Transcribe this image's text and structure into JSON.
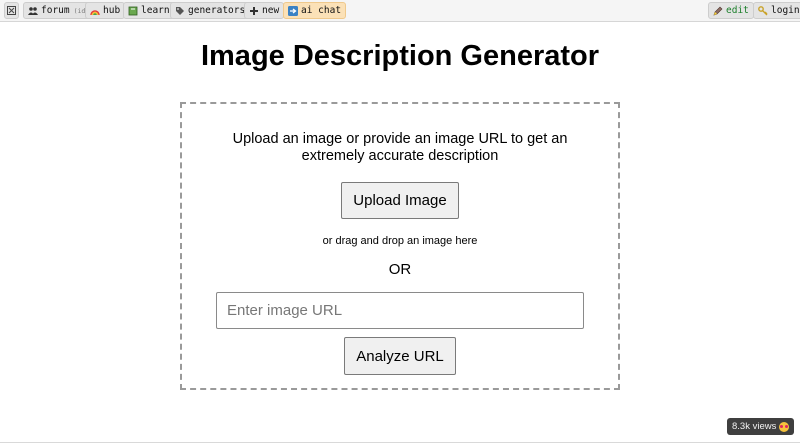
{
  "nav": {
    "left": [
      {
        "name": "nav-menu-toggle",
        "icon": "close-box-icon",
        "label": ""
      },
      {
        "name": "nav-forum",
        "icon": "users-icon",
        "label": "forum",
        "sub": "(id)"
      },
      {
        "name": "nav-hub",
        "icon": "rainbow-icon",
        "label": "hub"
      },
      {
        "name": "nav-learn",
        "icon": "book-icon",
        "label": "learn"
      },
      {
        "name": "nav-generators",
        "icon": "tag-icon",
        "label": "generators"
      },
      {
        "name": "nav-new",
        "icon": "plus-icon",
        "label": "new"
      },
      {
        "name": "nav-ai-chat",
        "icon": "arrow-icon",
        "label": "ai chat"
      }
    ],
    "right": [
      {
        "name": "nav-edit",
        "icon": "edit-icon",
        "label": "edit"
      },
      {
        "name": "nav-login",
        "icon": "key-icon",
        "label": "login"
      }
    ]
  },
  "main": {
    "title": "Image Description Generator",
    "instructions": "Upload an image or provide an image URL to get an extremely accurate description",
    "upload_button": "Upload Image",
    "drag_hint": "or drag and drop an image here",
    "or_text": "OR",
    "url_placeholder": "Enter image URL",
    "analyze_button": "Analyze URL"
  },
  "footer": {
    "views": "8.3k views"
  },
  "colors": {
    "active_tab": "#fbe1b7",
    "edit_label": "#1b7f2a",
    "badge_bg": "#3f3f3f"
  }
}
